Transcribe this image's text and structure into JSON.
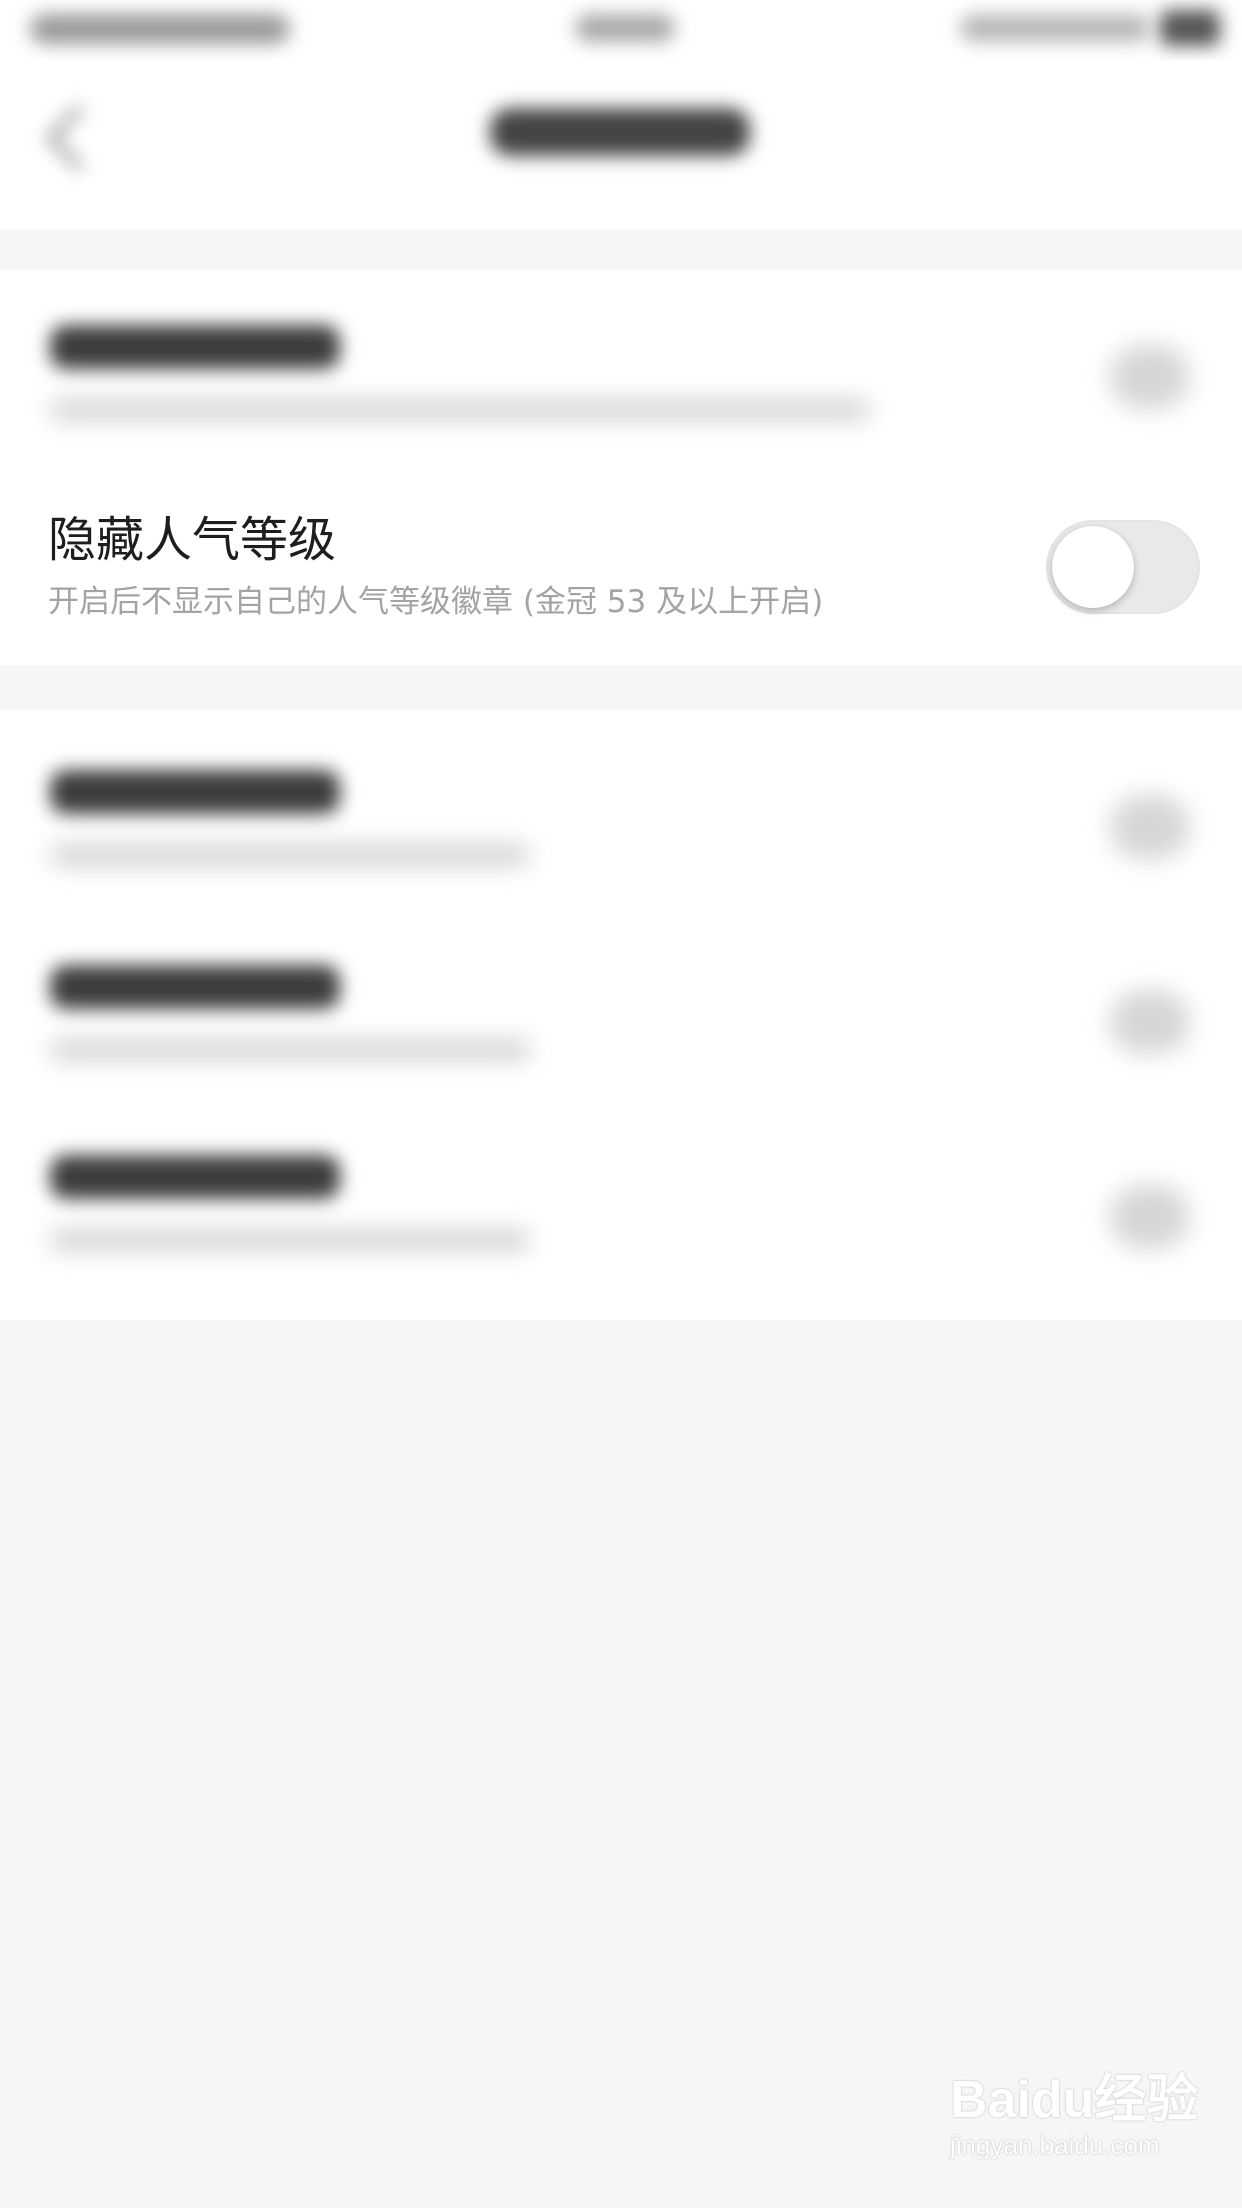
{
  "setting": {
    "title": "隐藏人气等级",
    "description": "开启后不显示自己的人气等级徽章 (金冠 53 及以上开启)",
    "enabled": false
  },
  "watermark": {
    "logo": "Baidu经验",
    "url": "jingyan.baidu.com"
  },
  "colors": {
    "background": "#f5f6f8",
    "card": "#ffffff",
    "title_text": "#1e1e1e",
    "description_text": "#a3a3a3",
    "toggle_off_track": "#e9e9ea"
  }
}
